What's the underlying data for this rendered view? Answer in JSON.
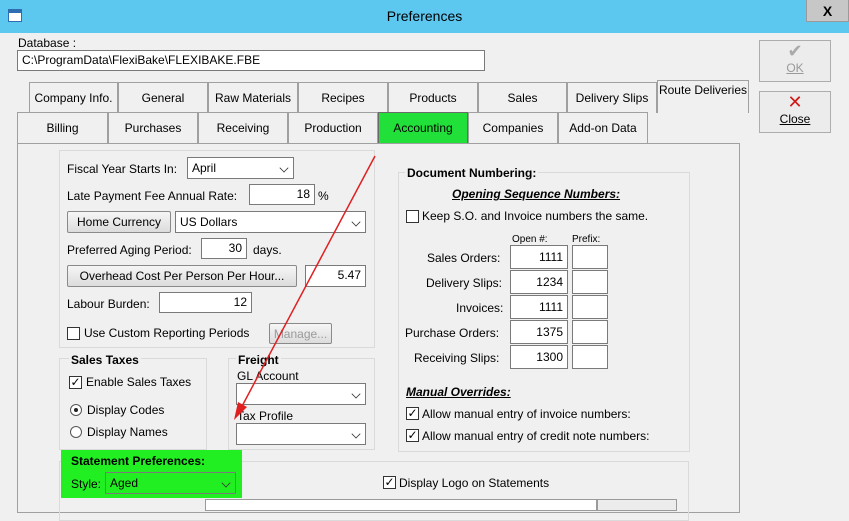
{
  "window": {
    "title": "Preferences",
    "close_glyph": "X"
  },
  "database": {
    "label": "Database :",
    "path": "C:\\ProgramData\\FlexiBake\\FLEXIBAKE.FBE"
  },
  "buttons": {
    "ok": "OK",
    "close": "Close",
    "ok_icon": "check-icon",
    "close_icon": "red-x-icon"
  },
  "tabs_row1": [
    "Company Info.",
    "General",
    "Raw Materials",
    "Recipes",
    "Products",
    "Sales",
    "Delivery Slips",
    "Route Deliveries"
  ],
  "tabs_row2": [
    "Billing",
    "Purchases",
    "Receiving",
    "Production",
    "Accounting",
    "Companies",
    "Add-on Data"
  ],
  "active_tab": "Accounting",
  "general": {
    "fiscal_label": "Fiscal Year Starts In:",
    "fiscal_value": "April",
    "late_fee_label": "Late Payment Fee Annual Rate:",
    "late_fee_value": "18",
    "late_fee_unit": "%",
    "home_currency_button": "Home Currency",
    "currency_value": "US Dollars",
    "aging_label": "Preferred Aging Period:",
    "aging_value": "30",
    "aging_unit": "days.",
    "overhead_button": "Overhead Cost Per Person Per Hour...",
    "overhead_value": "5.47",
    "labour_label": "Labour Burden:",
    "labour_value": "12",
    "custom_periods_label": "Use Custom Reporting Periods",
    "custom_periods_checked": false,
    "manage_button": "Manage..."
  },
  "sales_taxes": {
    "title": "Sales Taxes",
    "enable_label": "Enable Sales Taxes",
    "enable_checked": true,
    "display_codes": "Display Codes",
    "display_names": "Display Names",
    "selected": "Display Codes"
  },
  "freight": {
    "title": "Freight",
    "gl_label": "GL Account",
    "gl_value": "",
    "tax_label": "Tax Profile",
    "tax_value": ""
  },
  "statement": {
    "title": "Statement Preferences:",
    "style_label": "Style:",
    "style_value": "Aged",
    "logo_label": "Display Logo on Statements",
    "logo_checked": true,
    "highlight_color": "#22ef22"
  },
  "numbering": {
    "title": "Document Numbering:",
    "opening_title": "Opening Sequence Numbers:",
    "keep_label": "Keep S.O. and Invoice numbers the same.",
    "keep_checked": false,
    "col_open": "Open #:",
    "col_prefix": "Prefix:",
    "rows": [
      {
        "label": "Sales Orders:",
        "open": "1111",
        "prefix": ""
      },
      {
        "label": "Delivery Slips:",
        "open": "1234",
        "prefix": ""
      },
      {
        "label": "Invoices:",
        "open": "1111",
        "prefix": ""
      },
      {
        "label": "Purchase Orders:",
        "open": "1375",
        "prefix": ""
      },
      {
        "label": "Receiving Slips:",
        "open": "1300",
        "prefix": ""
      }
    ],
    "manual_title": "Manual Overrides:",
    "manual_invoice": "Allow manual entry of invoice numbers:",
    "manual_invoice_checked": true,
    "manual_credit": "Allow manual entry of credit note numbers:",
    "manual_credit_checked": true
  },
  "colors": {
    "titlebar": "#5cc8f0",
    "active_tab": "#22e03a",
    "annotation_arrow": "#e02020"
  }
}
